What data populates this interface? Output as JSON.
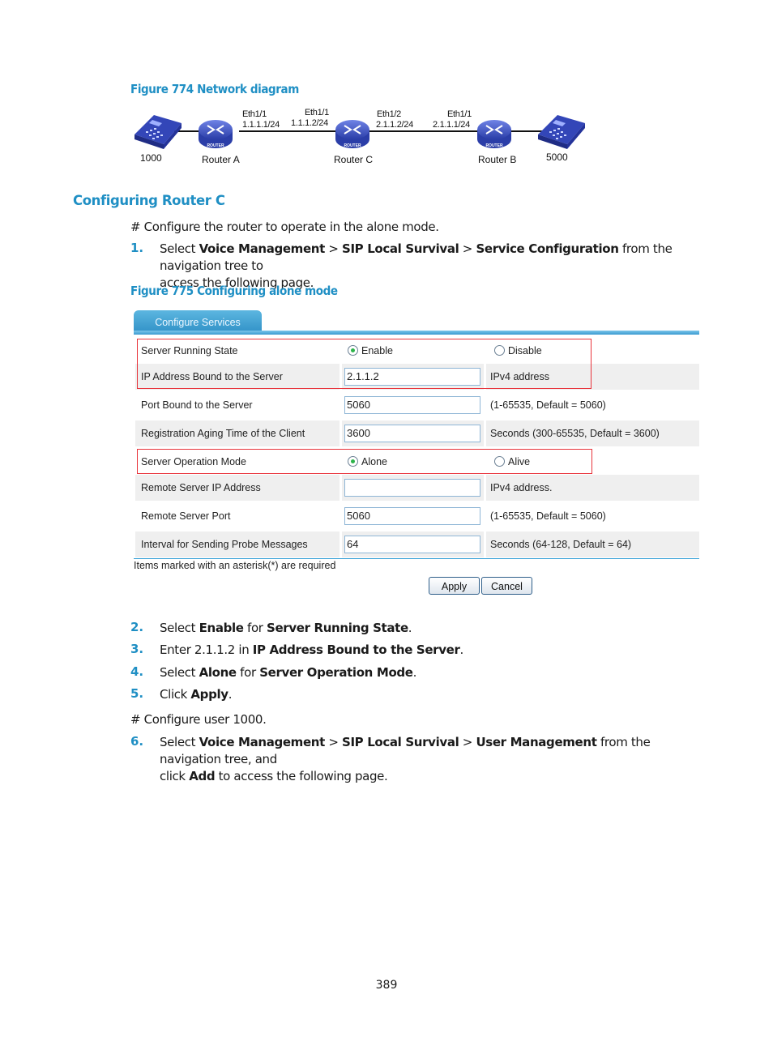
{
  "figure774": {
    "caption": "Figure 774 Network diagram",
    "nodes": [
      {
        "name": "1000",
        "type": "phone"
      },
      {
        "name": "Router A",
        "type": "router"
      },
      {
        "name": "Router C",
        "type": "router"
      },
      {
        "name": "Router B",
        "type": "router"
      },
      {
        "name": "5000",
        "type": "phone"
      }
    ],
    "router_badge": "ROUTER",
    "interfaces": [
      {
        "port": "Eth1/1",
        "ip": "1.1.1.1/24"
      },
      {
        "port": "Eth1/1",
        "ip": "1.1.1.2/24"
      },
      {
        "port": "Eth1/2",
        "ip": "2.1.1.2/24"
      },
      {
        "port": "Eth1/1",
        "ip": "2.1.1.1/24"
      }
    ]
  },
  "section": {
    "title": "Configuring Router C",
    "intro": "# Configure the router to operate in the alone mode."
  },
  "step1": {
    "num": "1.",
    "pre": "Select ",
    "b1": "Voice Management",
    "sep1": " > ",
    "b2": "SIP Local Survival",
    "sep2": " > ",
    "b3": "Service Configuration",
    "post": " from the navigation tree to",
    "line2": "access the following page."
  },
  "figure775": {
    "caption": "Figure 775 Configuring alone mode",
    "tab": "Configure Services",
    "rows": [
      {
        "label": "Server Running State",
        "option1": "Enable",
        "option2": "Disable",
        "selected": "Enable"
      },
      {
        "label": "IP Address Bound to the Server",
        "value": "2.1.1.2",
        "hint": "IPv4 address"
      },
      {
        "label": "Port Bound to the Server",
        "value": "5060",
        "hint": "(1-65535, Default = 5060)"
      },
      {
        "label": "Registration Aging Time of the Client",
        "value": "3600",
        "hint": "Seconds (300-65535, Default = 3600)"
      },
      {
        "label": "Server Operation Mode",
        "option1": "Alone",
        "option2": "Alive",
        "selected": "Alone"
      },
      {
        "label": "Remote Server IP Address",
        "value": "",
        "hint": "IPv4 address."
      },
      {
        "label": "Remote Server Port",
        "value": "5060",
        "hint": "(1-65535, Default = 5060)"
      },
      {
        "label": "Interval for Sending Probe Messages",
        "value": "64",
        "hint": "Seconds (64-128, Default = 64)"
      }
    ],
    "required_note": "Items marked with an asterisk(*) are required",
    "apply": "Apply",
    "cancel": "Cancel",
    "highlight_color": "#e8333b",
    "accent_color": "#2e8fc5"
  },
  "steps": [
    {
      "num": "2.",
      "pre": "Select ",
      "b1": "Enable",
      "mid": " for ",
      "b2": "Server Running State",
      "post": "."
    },
    {
      "num": "3.",
      "pre": "Enter 2.1.1.2 in ",
      "b1": "IP Address Bound to the Server",
      "post": "."
    },
    {
      "num": "4.",
      "pre": "Select ",
      "b1": "Alone",
      "mid": " for ",
      "b2": "Server Operation Mode",
      "post": "."
    },
    {
      "num": "5.",
      "pre": "Click ",
      "b1": "Apply",
      "post": "."
    }
  ],
  "configure_user": "# Configure user 1000.",
  "step6": {
    "num": "6.",
    "pre": "Select ",
    "b1": "Voice Management",
    "sep1": " > ",
    "b2": "SIP Local Survival",
    "sep2": " > ",
    "b3": "User Management",
    "post": " from the navigation tree, and",
    "line2_pre": "click ",
    "line2_b": "Add",
    "line2_post": " to access the following page."
  },
  "page_number": "389"
}
